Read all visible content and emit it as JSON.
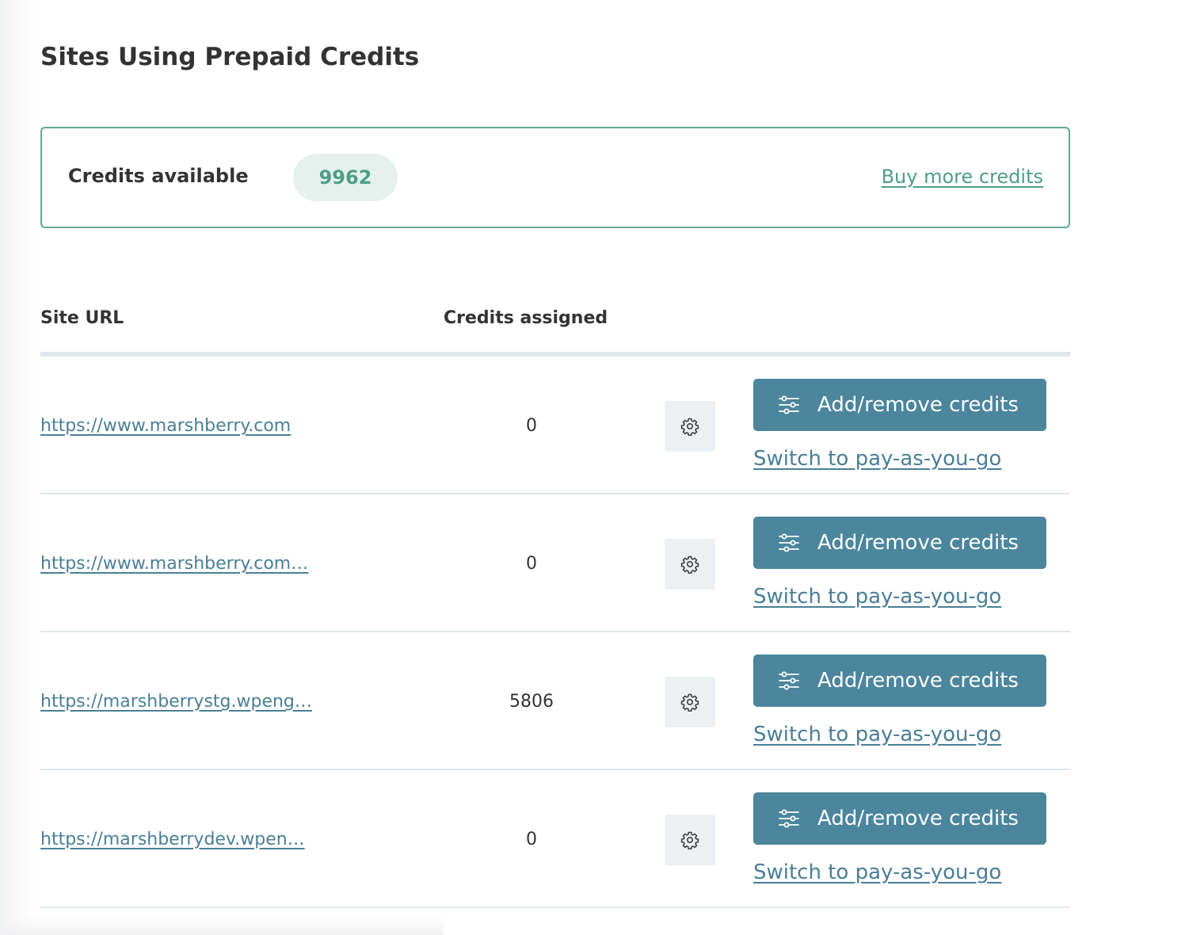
{
  "page": {
    "title": "Sites Using Prepaid Credits"
  },
  "credits": {
    "label": "Credits available",
    "value": "9962",
    "buy_link": "Buy more credits"
  },
  "table": {
    "headers": {
      "site_url": "Site URL",
      "credits_assigned": "Credits assigned"
    },
    "rows": [
      {
        "url": "https://www.marshberry.com",
        "credits": "0",
        "add_remove_label": "Add/remove credits",
        "switch_label": "Switch to pay-as-you-go"
      },
      {
        "url": "https://www.marshberry.com…",
        "credits": "0",
        "add_remove_label": "Add/remove credits",
        "switch_label": "Switch to pay-as-you-go"
      },
      {
        "url": "https://marshberrystg.wpeng…",
        "credits": "5806",
        "add_remove_label": "Add/remove credits",
        "switch_label": "Switch to pay-as-you-go"
      },
      {
        "url": "https://marshberrydev.wpen…",
        "credits": "0",
        "add_remove_label": "Add/remove credits",
        "switch_label": "Switch to pay-as-you-go"
      }
    ]
  },
  "icons": {
    "settings": "gear-icon",
    "adjust": "sliders-icon"
  },
  "colors": {
    "accent_green": "#4e9e86",
    "box_border": "#63a894",
    "badge_bg": "#e6f1ee",
    "button_bg": "#4b869d",
    "link_blue": "#4a7f96",
    "divider": "#dfe8ec",
    "gear_bg": "#ecf0f2"
  }
}
